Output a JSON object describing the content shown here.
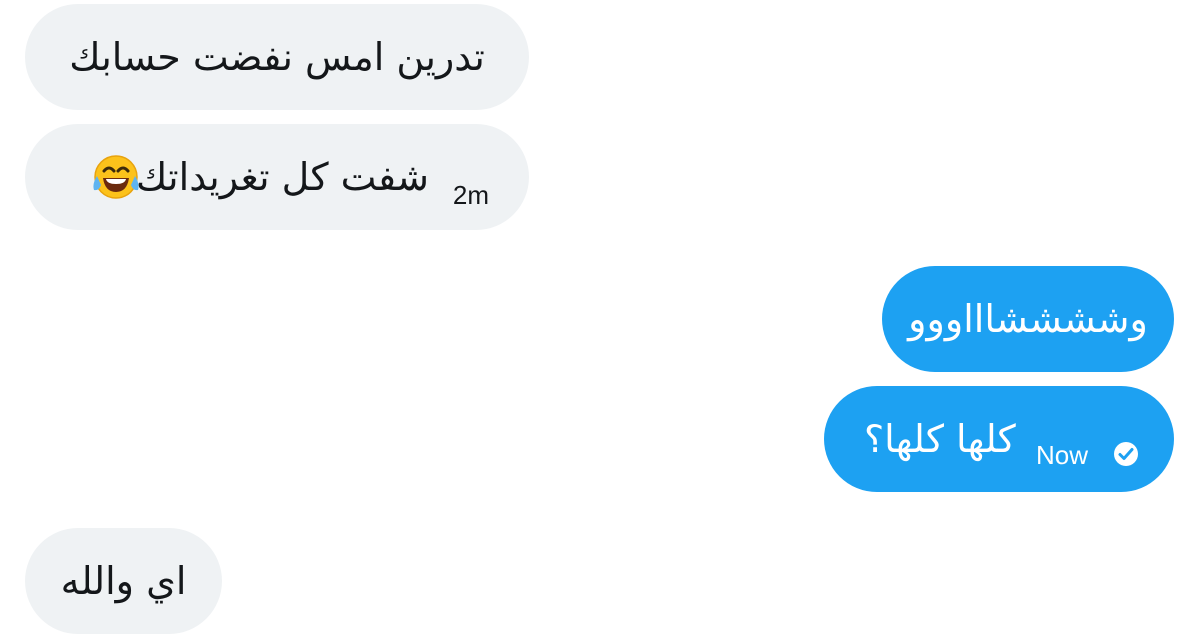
{
  "messages": [
    {
      "direction": "incoming",
      "text": "تدرين امس نفضت حسابك"
    },
    {
      "direction": "incoming",
      "text": "شفت كل تغريداتك",
      "emoji": "face-with-tears-of-joy",
      "timestamp": "2m"
    },
    {
      "direction": "outgoing",
      "text": "وششششاااووو"
    },
    {
      "direction": "outgoing",
      "text": "كلها كلها؟",
      "timestamp": "Now",
      "status_icon": "read-check-icon"
    },
    {
      "direction": "incoming",
      "text": "اي والله"
    }
  ],
  "colors": {
    "incoming_bubble": "#eff2f4",
    "outgoing_bubble": "#1da1f2",
    "incoming_text": "#14171a",
    "outgoing_text": "#ffffff"
  }
}
